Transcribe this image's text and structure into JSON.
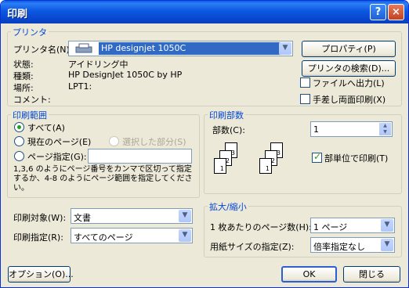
{
  "window": {
    "title": "印刷",
    "help_icon": "?",
    "close_icon": "×"
  },
  "printer": {
    "legend": "プリンタ",
    "name_label": "プリンタ名(N):",
    "selected": "HP designjet 1050C",
    "properties_btn": "プロパティ(P)",
    "find_btn": "プリンタの検索(D)...",
    "status_label": "状態:",
    "status_value": "アイドリング中",
    "type_label": "種類:",
    "type_value": "HP DesignJet 1050C by HP",
    "where_label": "場所:",
    "where_value": "LPT1:",
    "comment_label": "コメント:",
    "print_to_file": "ファイルへ出力(L)",
    "manual_duplex": "手差し両面印刷(X)"
  },
  "range": {
    "legend": "印刷範囲",
    "all": "すべて(A)",
    "current": "現在のページ(E)",
    "selection": "選択した部分(S)",
    "pages": "ページ指定(G):",
    "pages_value": "",
    "hint": "1,3,6 のようにページ番号をカンマで区切って指定するか、4-8 のようにページ範囲を指定してください。"
  },
  "copies": {
    "legend": "印刷部数",
    "count_label": "部数(C):",
    "count_value": "1",
    "collate": "部単位で印刷(T)"
  },
  "bottom": {
    "print_what_label": "印刷対象(W):",
    "print_what_value": "文書",
    "print_label": "印刷指定(R):",
    "print_value": "すべてのページ"
  },
  "zoom": {
    "legend": "拡大/縮小",
    "pps_label": "1 枚あたりのページ数(H):",
    "pps_value": "1 ページ",
    "scale_label": "用紙サイズの指定(Z):",
    "scale_value": "倍率指定なし"
  },
  "buttons": {
    "options": "オプション(O)...",
    "ok": "OK",
    "close": "閉じる"
  }
}
